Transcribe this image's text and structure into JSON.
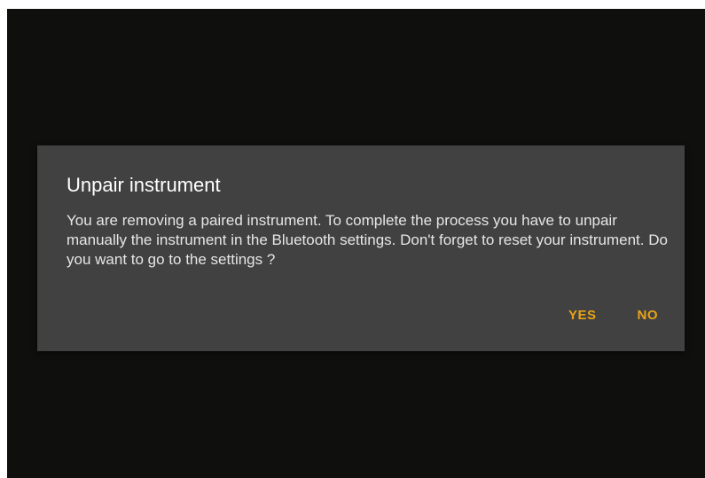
{
  "dialog": {
    "title": "Unpair instrument",
    "message": "You are removing a paired instrument. To complete the process you have to unpair manually the instrument in the Bluetooth settings. Don't forget to reset your instrument. Do you want to go to the settings ?",
    "yes_label": "YES",
    "no_label": "NO"
  },
  "colors": {
    "accent": "#e8a317",
    "dialog_background": "#414141",
    "screen_background": "#0f0f0e"
  }
}
